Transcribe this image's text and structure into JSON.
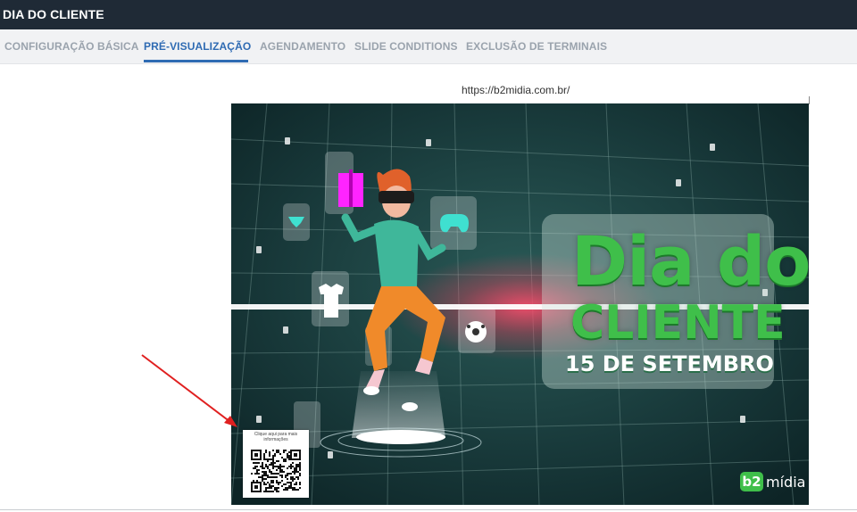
{
  "window": {
    "title": "DIA DO CLIENTE"
  },
  "tabs": [
    {
      "label": "CONFIGURAÇÃO BÁSICA",
      "active": false
    },
    {
      "label": "PRÉ-VISUALIZAÇÃO",
      "active": true
    },
    {
      "label": "AGENDAMENTO",
      "active": false
    },
    {
      "label": "SLIDE CONDITIONS",
      "active": false
    },
    {
      "label": "EXCLUSÃO DE TERMINAIS",
      "active": false
    }
  ],
  "preview": {
    "url": "https://b2midia.com.br/",
    "banner": {
      "title_line1": "Dia do",
      "title_line2": "CLIENTE",
      "date": "15 DE SETEMBRO",
      "brand_badge": "b2",
      "brand_word": "mídia"
    },
    "qr": {
      "caption": "Clique aqui para mais informações"
    }
  },
  "colors": {
    "titlebar": "#1f2a36",
    "tab_active": "#2f6bb3",
    "tab_inactive": "#9aa3ad",
    "banner_green": "#3fbf4a",
    "arrow": "#e02020"
  },
  "icons": [
    "gift-icon",
    "diamond-icon",
    "shirt-icon",
    "gamepad-icon",
    "soccer-ball-icon",
    "vr-person-icon",
    "arrow-icon",
    "qr-code-icon"
  ]
}
